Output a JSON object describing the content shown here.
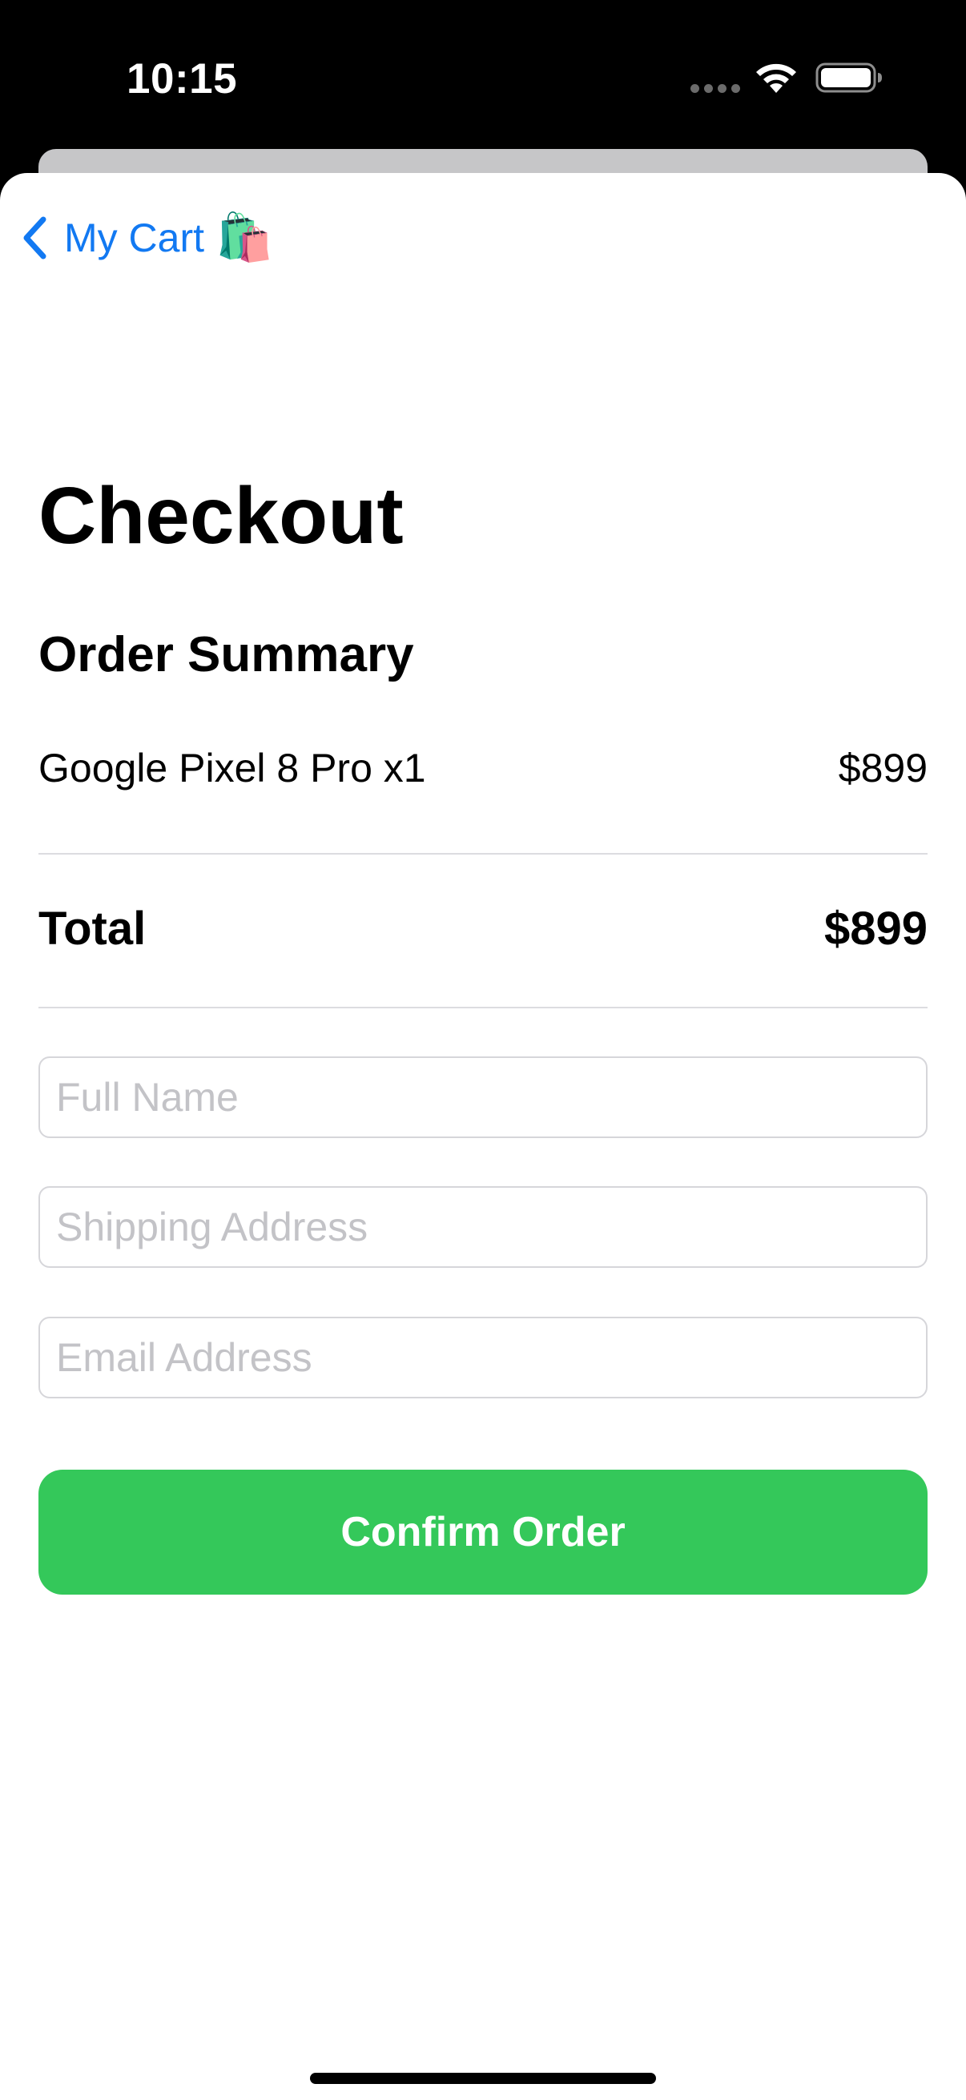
{
  "status_bar": {
    "time": "10:15",
    "icons": [
      "cellular-signal-icon",
      "wifi-icon",
      "battery-icon"
    ]
  },
  "nav": {
    "back_label": "My Cart",
    "back_emoji": "🛍️",
    "back_icon": "chevron-left-icon",
    "accent_color": "#1279F2"
  },
  "page": {
    "title": "Checkout"
  },
  "order_summary": {
    "heading": "Order Summary",
    "items": [
      {
        "name": "Google Pixel 8 Pro x1",
        "price": "$899"
      }
    ],
    "total_label": "Total",
    "total_value": "$899"
  },
  "form": {
    "full_name": {
      "value": "",
      "placeholder": "Full Name"
    },
    "shipping_address": {
      "value": "",
      "placeholder": "Shipping Address"
    },
    "email_address": {
      "value": "",
      "placeholder": "Email Address"
    }
  },
  "actions": {
    "confirm_label": "Confirm Order",
    "confirm_color": "#34C85A"
  }
}
